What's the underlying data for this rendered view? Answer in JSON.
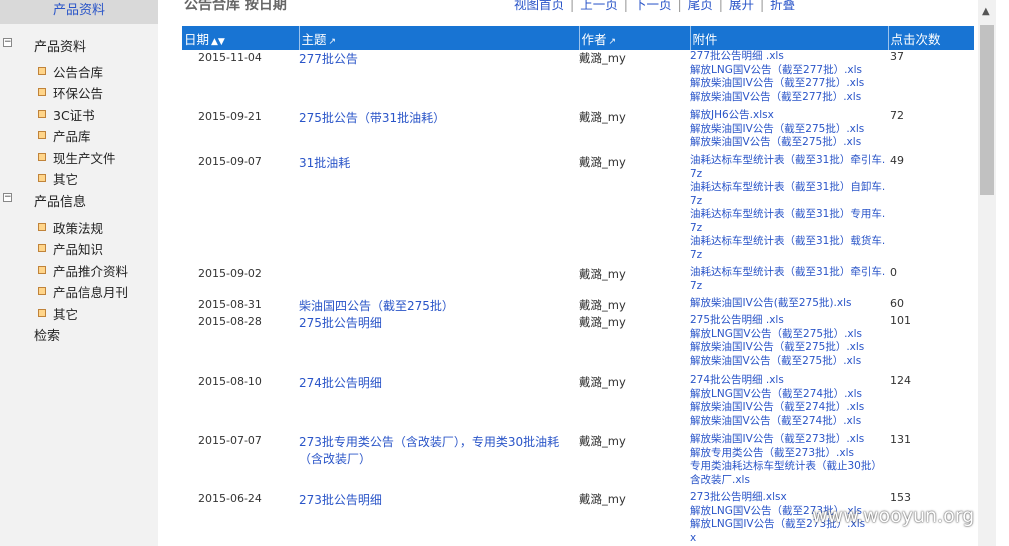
{
  "sidebar": {
    "header": "产品资料",
    "sec1": {
      "toggle": "−",
      "label": "产品资料"
    },
    "items1": [
      "公告合库",
      "环保公告",
      "3C证书",
      "产品库",
      "现生产文件",
      "其它"
    ],
    "sec2": {
      "toggle": "−",
      "label": "产品信息"
    },
    "items2": [
      "政策法规",
      "产品知识",
      "产品推介资料",
      "产品信息月刊",
      "其它"
    ],
    "search": "检索"
  },
  "main": {
    "title": "公告合库  按日期",
    "pager": [
      "视图首页",
      "上一页",
      "下一页",
      "尾页",
      "展开",
      "折叠"
    ],
    "columns": {
      "date": "日期",
      "subject": "主题",
      "author": "作者",
      "attach": "附件",
      "clicks": "点击次数"
    }
  },
  "rows": [
    {
      "date": "2015-11-04",
      "subject": "277批公告",
      "author": "戴潞_my",
      "attachments": [
        "277批公告明细 .xls",
        "解放LNG国V公告（截至277批）.xls",
        "解放柴油国IV公告（截至277批）.xls",
        "解放柴油国V公告（截至277批）.xls"
      ],
      "clicks": "37"
    },
    {
      "date": "2015-09-21",
      "subject": "275批公告（带31批油耗）",
      "author": "戴潞_my",
      "attachments": [
        "解放JH6公告.xlsx",
        "解放柴油国IV公告（截至275批）.xls",
        "解放柴油国V公告（截至275批）.xls"
      ],
      "clicks": "72"
    },
    {
      "date": "2015-09-07",
      "subject": "31批油耗",
      "author": "戴潞_my",
      "attachments": [
        "油耗达标车型统计表（截至31批）牵引车.7z",
        "油耗达标车型统计表（截至31批）自卸车.7z",
        "油耗达标车型统计表（截至31批）专用车.7z",
        "油耗达标车型统计表（截至31批）载货车.7z"
      ],
      "clicks": "49"
    },
    {
      "date": "2015-09-02",
      "subject": "",
      "author": "戴潞_my",
      "attachments": [
        "油耗达标车型统计表（截至31批）牵引车.7z"
      ],
      "clicks": "0"
    },
    {
      "date": "2015-08-31",
      "subject": "柴油国四公告（截至275批）",
      "author": "戴潞_my",
      "attachments": [
        "解放柴油国IV公告(截至275批).xls"
      ],
      "clicks": "60"
    },
    {
      "date": "2015-08-28",
      "subject": "275批公告明细",
      "author": "戴潞_my",
      "attachments": [
        "275批公告明细 .xls",
        "解放LNG国V公告（截至275批）.xls",
        "解放柴油国IV公告（截至275批）.xls",
        "解放柴油国V公告（截至275批）.xls"
      ],
      "clicks": "101"
    },
    {
      "date": "2015-08-10",
      "subject": "274批公告明细",
      "author": "戴潞_my",
      "attachments": [
        "274批公告明细 .xls",
        "解放LNG国V公告（截至274批）.xls",
        "解放柴油国IV公告（截至274批）.xls",
        "解放柴油国V公告（截至274批）.xls"
      ],
      "clicks": "124"
    },
    {
      "date": "2015-07-07",
      "subject": "273批专用类公告（含改装厂），专用类30批油耗（含改装厂）",
      "author": "戴潞_my",
      "attachments": [
        "解放柴油国IV公告（截至273批）.xls",
        "解放专用类公告（截至273批）.xls",
        "专用类油耗达标车型统计表（截止30批）含改装厂.xls"
      ],
      "clicks": "131"
    },
    {
      "date": "2015-06-24",
      "subject": "273批公告明细",
      "author": "戴潞_my",
      "attachments": [
        "273批公告明细.xlsx",
        "解放LNG国V公告（截至273批）.xls",
        "解放LNG国IV公告（截至273批）.xls",
        "x"
      ],
      "clicks": "153"
    }
  ],
  "watermark": "www.wooyun.org"
}
